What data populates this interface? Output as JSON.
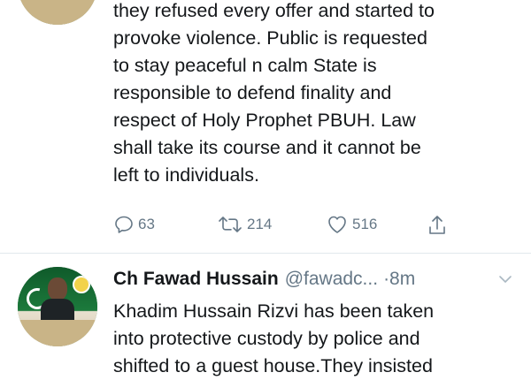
{
  "tweet1": {
    "lines": [
      "they refused every offer and started to",
      "provoke violence. Public is requested",
      "to stay peaceful n calm State is",
      "responsible to defend finality and",
      "respect of Holy Prophet PBUH. Law",
      "shall take its course and it cannot be",
      "left to individuals."
    ],
    "actions": {
      "reply_count": "63",
      "retweet_count": "214",
      "like_count": "516",
      "share_icon": "share-icon"
    }
  },
  "tweet2": {
    "author": {
      "name": "Ch Fawad Hussain",
      "handle": "@fawadc...",
      "time": "·8m"
    },
    "lines": [
      "Khadim Hussain Rizvi has been taken",
      "into protective custody by police and",
      "shifted to a guest house.They insisted"
    ]
  },
  "colors": {
    "text": "#14171a",
    "muted": "#657786",
    "divider": "#e1e8ed"
  }
}
